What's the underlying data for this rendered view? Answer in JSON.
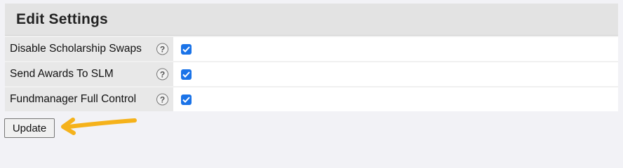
{
  "panel": {
    "title": "Edit Settings",
    "rows": [
      {
        "label": "Disable Scholarship Swaps",
        "help_icon": "question-circle-icon",
        "checked": true
      },
      {
        "label": "Send Awards To SLM",
        "help_icon": "question-circle-icon",
        "checked": true
      },
      {
        "label": "Fundmanager Full Control",
        "help_icon": "question-circle-icon",
        "checked": true
      }
    ]
  },
  "actions": {
    "update_label": "Update"
  },
  "colors": {
    "checkbox_accent": "#1a73e8",
    "annotation_arrow": "#f5b21b"
  }
}
